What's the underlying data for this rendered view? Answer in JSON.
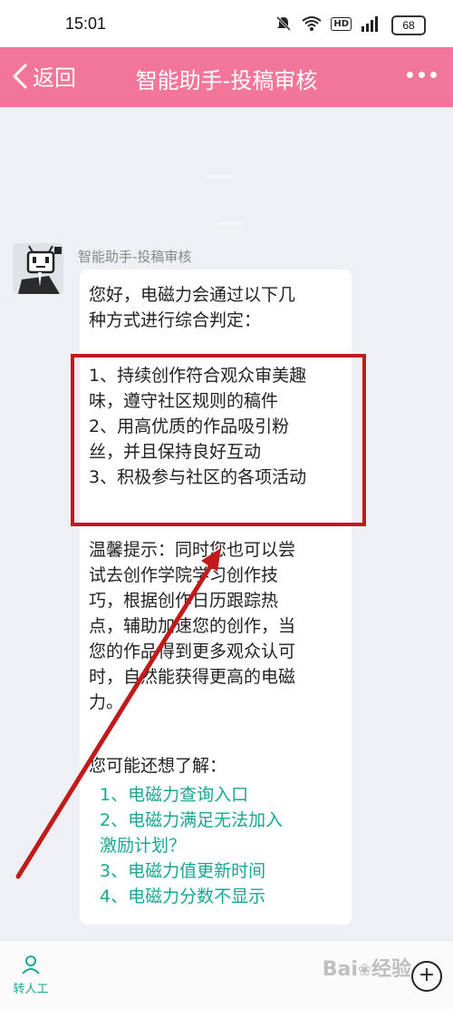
{
  "status": {
    "time": "15:01",
    "battery": "68",
    "hd": "HD"
  },
  "header": {
    "back_label": "返回",
    "title": "智能助手-投稿审核"
  },
  "message": {
    "sender": "智能助手-投稿审核",
    "intro": [
      "您好，电磁力会通过以下几",
      "种方式进行综合判定："
    ],
    "points": [
      "1、持续创作符合观众审美趣",
      "味，遵守社区规则的稿件",
      "2、用高优质的作品吸引粉",
      "丝，并且保持良好互动",
      "3、积极参与社区的各项活动"
    ],
    "tip": [
      "温馨提示：同时您也可以尝",
      "试去创作学院学习创作技",
      "巧，根据创作日历跟踪热",
      "点，辅助加速您的创作，当",
      "您的作品得到更多观众认可",
      "时，自然能获得更高的电磁",
      "力。"
    ],
    "related_title": "您可能还想了解：",
    "related": [
      "1、电磁力查询入口",
      "2、电磁力满足无法加入",
      "激励计划？",
      "3、电磁力值更新时间",
      "4、电磁力分数不显示"
    ]
  },
  "footer": {
    "human_label": "转人工"
  },
  "colors": {
    "header": "#f2769a",
    "link": "#1aa594",
    "annotation": "#c21a1a"
  }
}
